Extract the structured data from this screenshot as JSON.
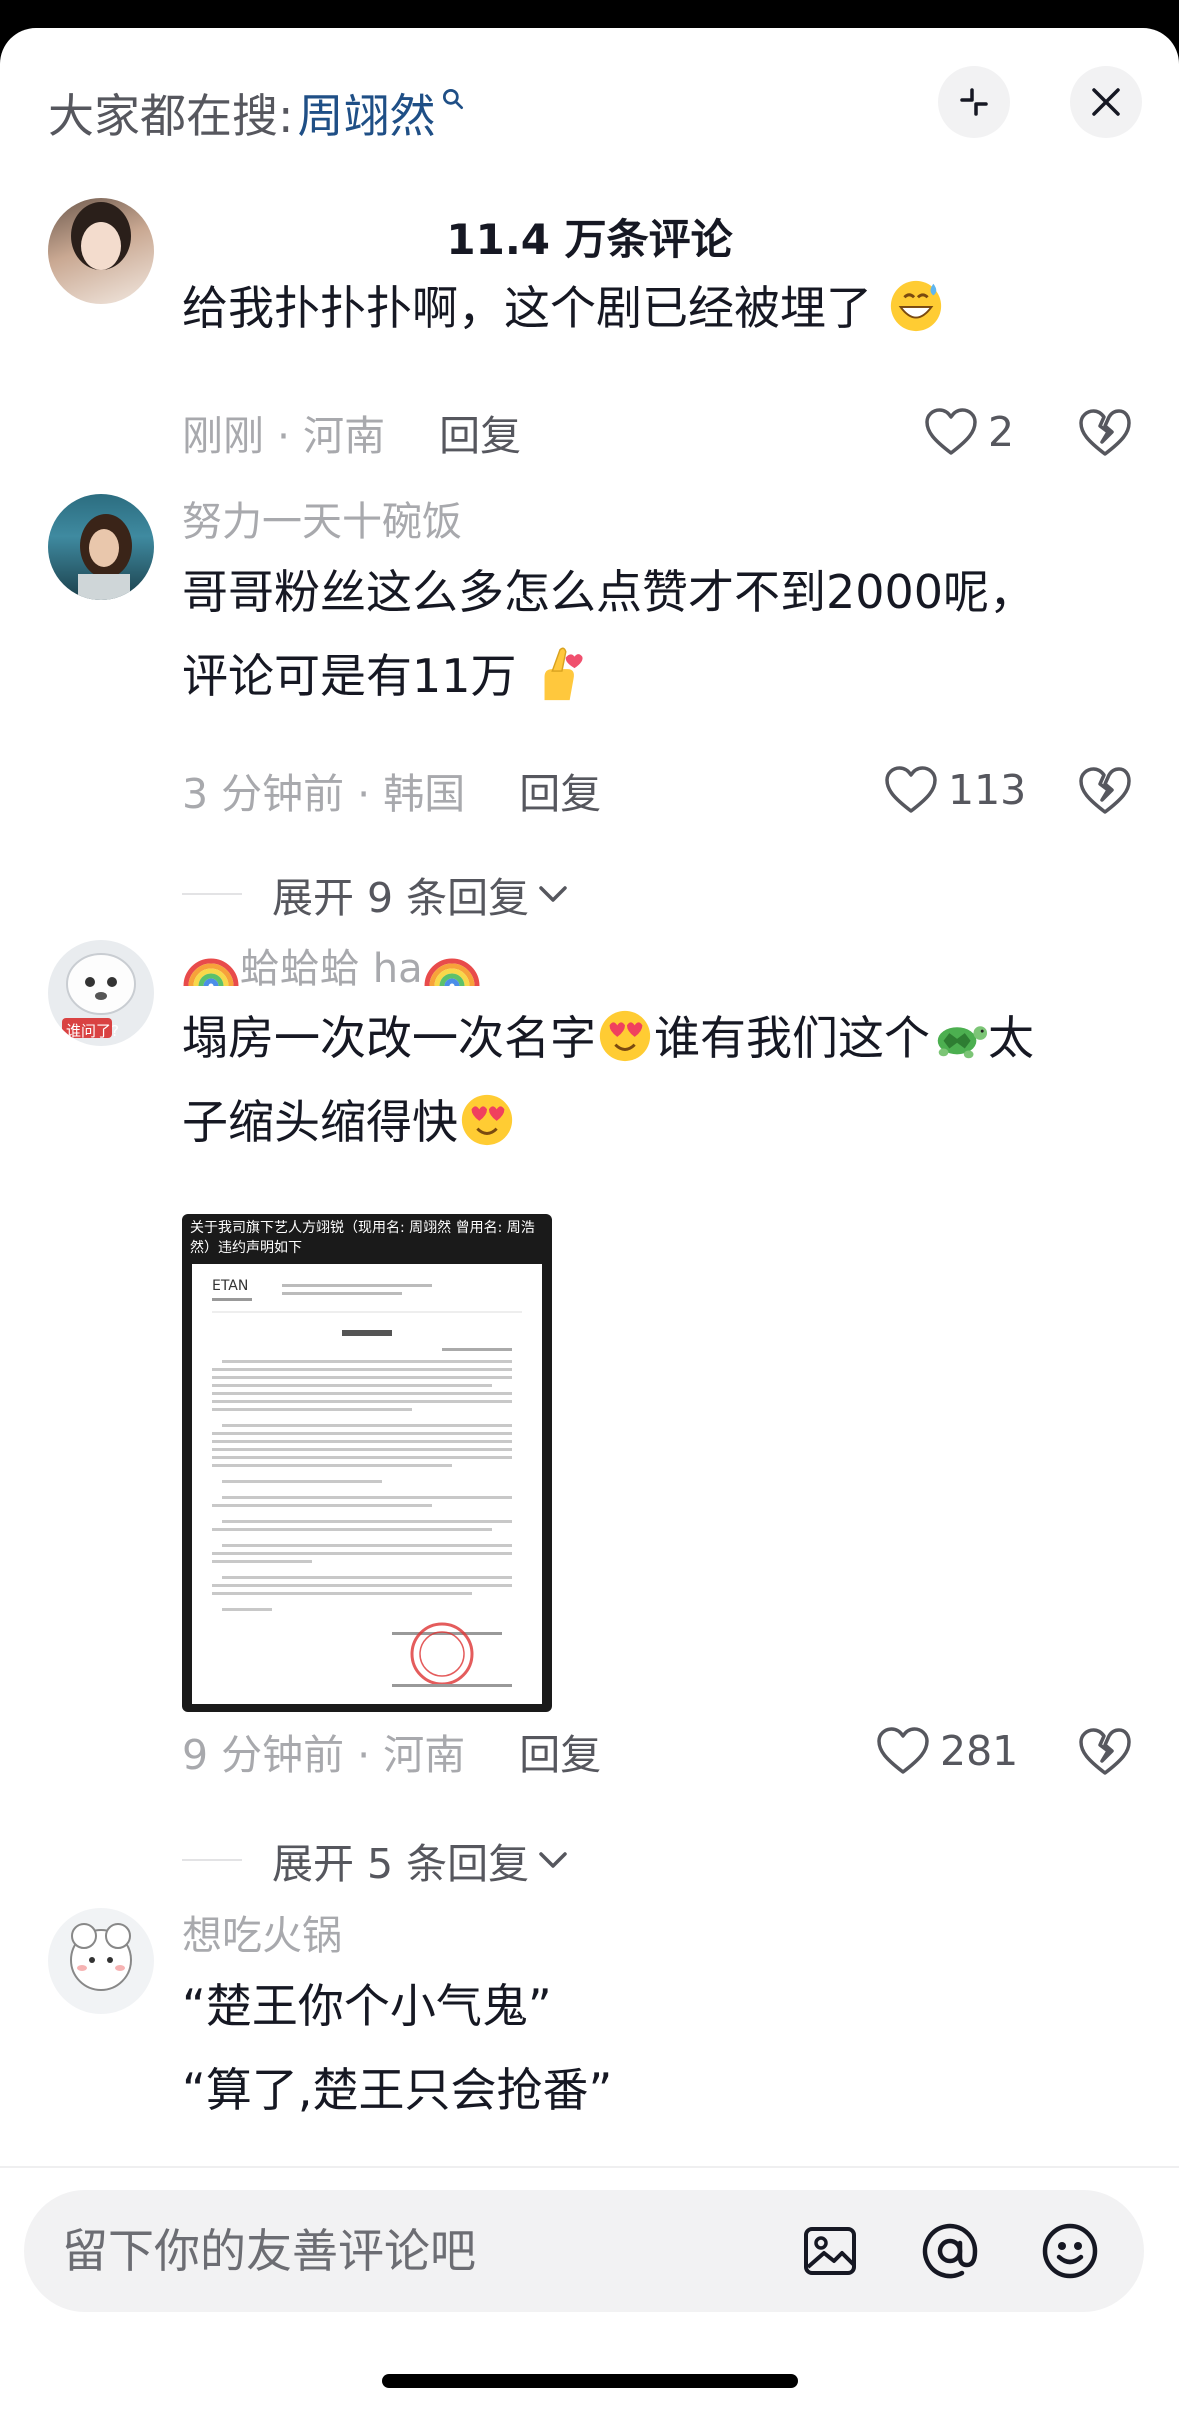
{
  "header": {
    "search_prefix": "大家都在搜:",
    "search_term": "周翊然",
    "comment_count": "11.4 万条评论"
  },
  "comments": [
    {
      "username": "",
      "lines": [
        "给我扑扑扑啊，这个剧已经被埋了"
      ],
      "emoji": "grinning-sweat-emoji",
      "time_location": "刚刚 · 河南",
      "reply_label": "回复",
      "likes": "2"
    },
    {
      "username": "努力一天十碗饭",
      "lines": [
        "哥哥粉丝这么多怎么点赞才不到2000呢，",
        "评论可是有11万"
      ],
      "emoji": "finger-heart-emoji",
      "time_location": "3 分钟前 · 韩国",
      "reply_label": "回复",
      "likes": "113",
      "expand_label": "展开 9 条回复"
    },
    {
      "username": "蛤蛤蛤 ha",
      "avatar_label": "谁问了?",
      "lines": [
        "塌房一次改一次名字",
        "谁有我们这个",
        "太",
        "子缩头缩得快"
      ],
      "attachment_caption": "关于我司旗下艺人方翊锐（现用名: 周翊然 曾用名: 周浩然）违约声明如下",
      "time_location": "9 分钟前 · 河南",
      "reply_label": "回复",
      "likes": "281",
      "expand_label": "展开 5 条回复"
    },
    {
      "username": "想吃火锅",
      "lines": [
        "“楚王你个小气鬼”",
        "“算了,楚王只会抢番”"
      ]
    }
  ],
  "input": {
    "placeholder": "留下你的友善评论吧"
  },
  "colors": {
    "link": "#1f4f86",
    "muted": "#a8a9ad",
    "primary_text": "#161823"
  }
}
